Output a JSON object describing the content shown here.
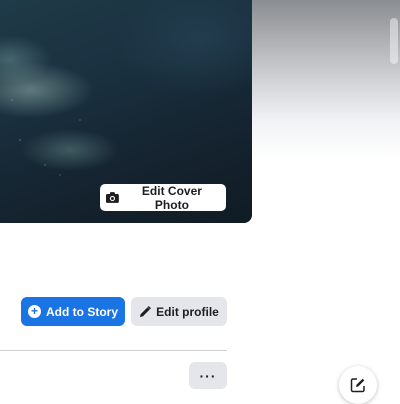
{
  "cover": {
    "edit_cover_label": "Edit Cover Photo",
    "camera_icon": "camera-icon"
  },
  "actions": {
    "add_story_label": "Add to Story",
    "add_story_icon": "plus-circle-icon",
    "edit_profile_label": "Edit profile",
    "edit_profile_icon": "pencil-icon",
    "more_label": "···"
  },
  "floating": {
    "new_message_icon": "compose-icon"
  },
  "colors": {
    "primary": "#1b74e4",
    "secondary_button": "#e4e6eb",
    "text": "#1c1e21"
  }
}
